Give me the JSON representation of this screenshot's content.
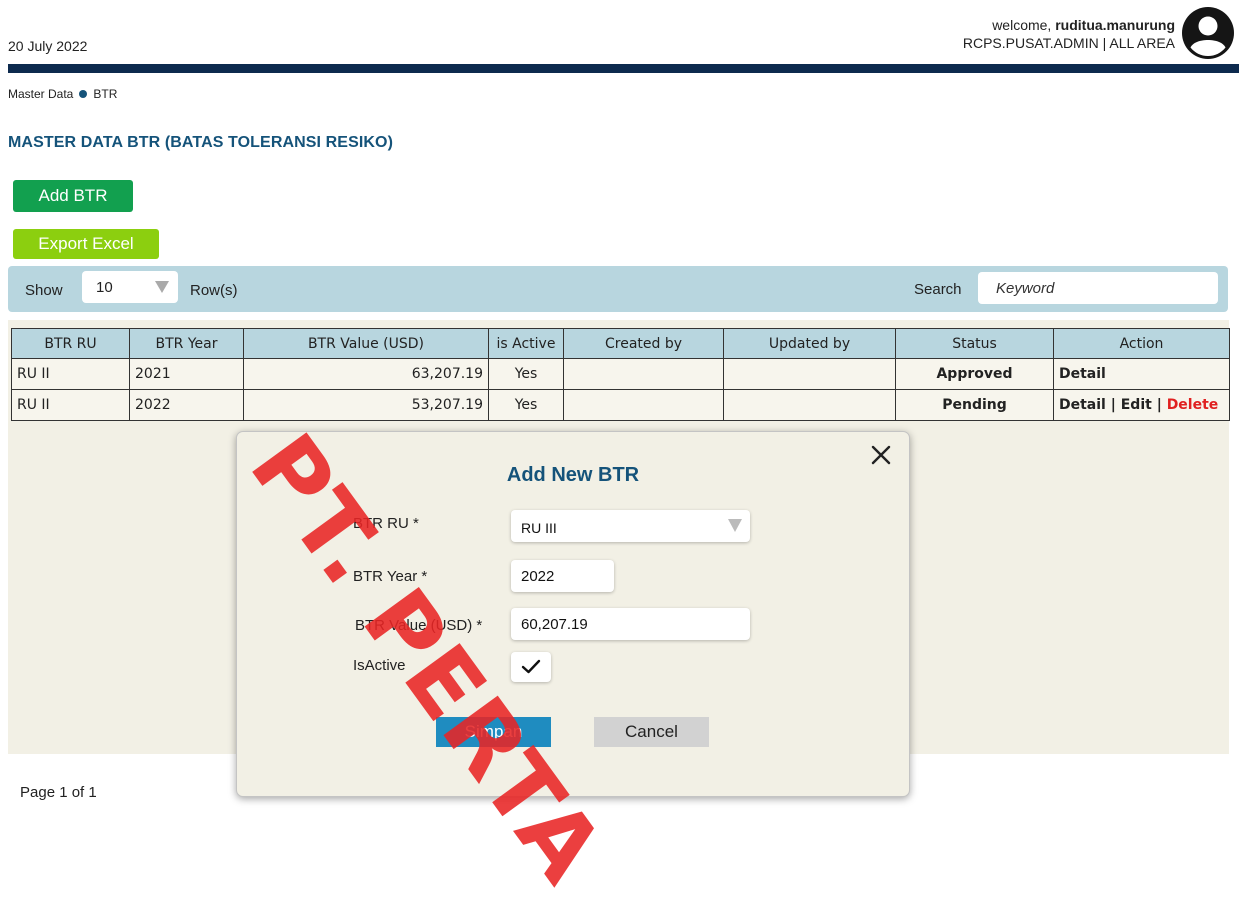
{
  "header": {
    "date": "20 July 2022",
    "welcome_prefix": "welcome,",
    "username": "ruditua.manurung",
    "role": "RCPS.PUSAT.ADMIN | ALL AREA",
    "avatar_icon": "user-circle-icon"
  },
  "breadcrumb": {
    "root": "Master Data",
    "current": "BTR"
  },
  "page": {
    "title": "MASTER DATA BTR (BATAS  TOLERANSI  RESIKO)"
  },
  "actions": {
    "add_label": "Add BTR",
    "export_label": "Export Excel"
  },
  "toolbar": {
    "show_label": "Show",
    "rows_value": "10",
    "rows_suffix": "Row(s)",
    "search_label": "Search",
    "search_placeholder": "Keyword"
  },
  "table": {
    "headers": [
      "BTR RU",
      "BTR Year",
      "BTR Value (USD)",
      "is Active",
      "Created by",
      "Updated by",
      "Status",
      "Action"
    ],
    "rows": [
      {
        "ru": "RU II",
        "year": "2021",
        "value": "63,207.19",
        "active": "Yes",
        "created_by": "",
        "updated_by": "",
        "status": "Approved",
        "actions": [
          "Detail"
        ]
      },
      {
        "ru": "RU II",
        "year": "2022",
        "value": "53,207.19",
        "active": "Yes",
        "created_by": "",
        "updated_by": "",
        "status": "Pending",
        "actions": [
          "Detail",
          "Edit",
          "Delete"
        ]
      }
    ],
    "action_separator": "|"
  },
  "pager": {
    "text": "Page 1 of 1"
  },
  "modal": {
    "title": "Add New BTR",
    "close_icon": "close-icon",
    "fields": {
      "ru_label": "BTR  RU *",
      "ru_value": "RU III",
      "year_label": "BTR Year *",
      "year_value": "2022",
      "value_label": "BTR Value (USD) *",
      "value_value": "60,207.19",
      "active_label": "IsActive",
      "active_checked": true,
      "check_mark": "✓"
    },
    "save_label": "Simpan",
    "cancel_label": "Cancel"
  },
  "watermark": {
    "text": "PT. PERTA"
  },
  "colors": {
    "navy_bar": "#0d2a4e",
    "title_blue": "#15537a",
    "add_green": "#12a04f",
    "export_green": "#8ccf0f",
    "toolbar_blue": "#b8d6df",
    "approved_green": "#6aa84f",
    "delete_red": "#e02020",
    "save_blue": "#1f8cc0"
  }
}
